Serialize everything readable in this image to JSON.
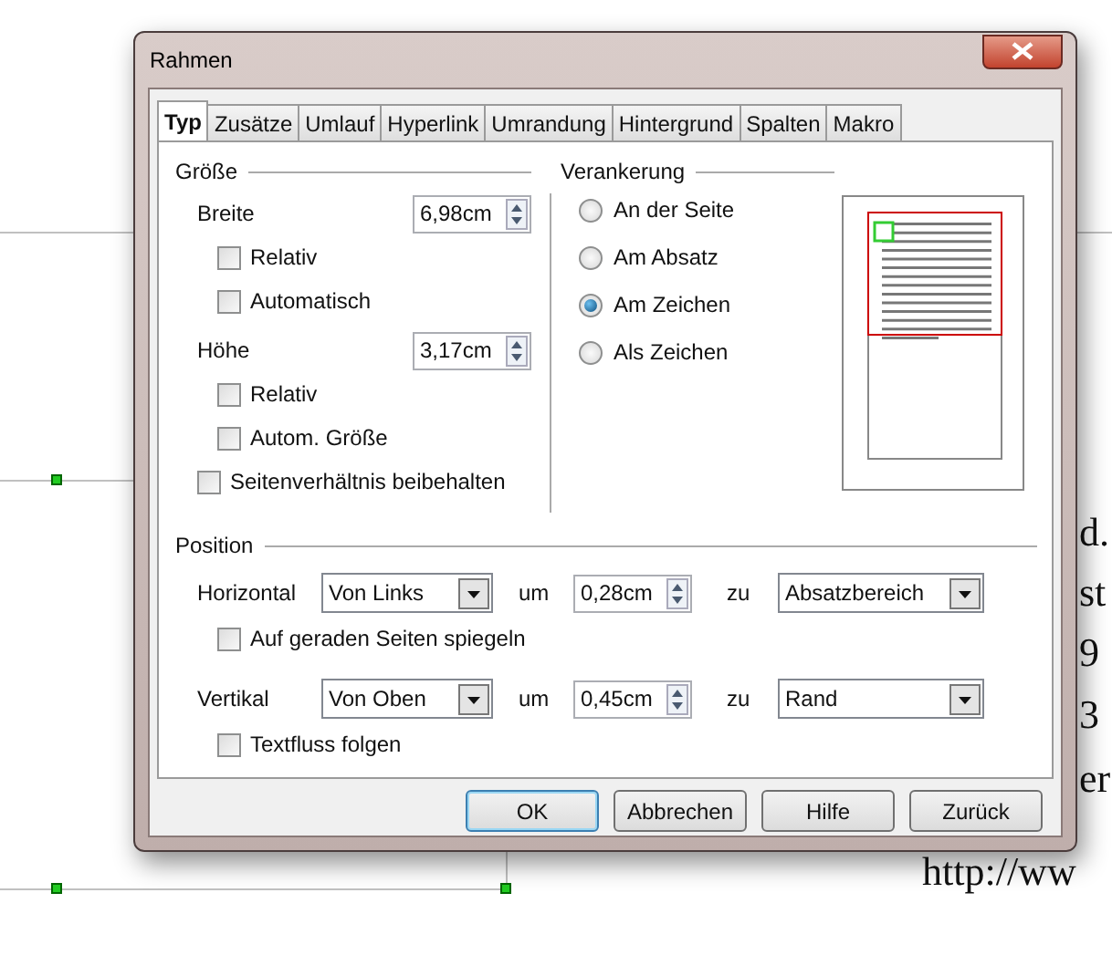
{
  "document": {
    "text_fragments": [
      "d.",
      "st",
      "9",
      "3",
      "er",
      "http://ww"
    ]
  },
  "dialog": {
    "title": "Rahmen",
    "tabs": [
      {
        "label": "Typ",
        "selected": true
      },
      {
        "label": "Zusätze",
        "selected": false
      },
      {
        "label": "Umlauf",
        "selected": false
      },
      {
        "label": "Hyperlink",
        "selected": false
      },
      {
        "label": "Umrandung",
        "selected": false
      },
      {
        "label": "Hintergrund",
        "selected": false
      },
      {
        "label": "Spalten",
        "selected": false
      },
      {
        "label": "Makro",
        "selected": false
      }
    ],
    "size": {
      "title": "Größe",
      "width": {
        "label": "Breite",
        "value": "6,98cm"
      },
      "width_options": [
        {
          "label": "Relativ",
          "checked": false
        },
        {
          "label": "Automatisch",
          "checked": false
        }
      ],
      "height": {
        "label": "Höhe",
        "value": "3,17cm"
      },
      "height_options": [
        {
          "label": "Relativ",
          "checked": false
        },
        {
          "label": "Autom. Größe",
          "checked": false
        }
      ],
      "keep_ratio": {
        "label": "Seitenverhältnis beibehalten",
        "checked": false
      }
    },
    "anchor": {
      "title": "Verankerung",
      "options": [
        {
          "label": "An der Seite",
          "selected": false
        },
        {
          "label": "Am Absatz",
          "selected": false
        },
        {
          "label": "Am Zeichen",
          "selected": true
        },
        {
          "label": "Als Zeichen",
          "selected": false
        }
      ]
    },
    "position": {
      "title": "Position",
      "rows": [
        {
          "label": "Horizontal",
          "select": "Von Links",
          "by_label": "um",
          "offset": "0,28cm",
          "to_label": "zu",
          "to_select": "Absatzbereich",
          "option": {
            "label": "Auf geraden Seiten spiegeln",
            "checked": false
          }
        },
        {
          "label": "Vertikal",
          "select": "Von Oben",
          "by_label": "um",
          "offset": "0,45cm",
          "to_label": "zu",
          "to_select": "Rand",
          "option": {
            "label": "Textfluss folgen",
            "checked": false
          }
        }
      ]
    },
    "buttons": [
      {
        "label": "OK",
        "default": true
      },
      {
        "label": "Abbrechen",
        "default": false
      },
      {
        "label": "Hilfe",
        "default": false
      },
      {
        "label": "Zurück",
        "default": false
      }
    ]
  }
}
